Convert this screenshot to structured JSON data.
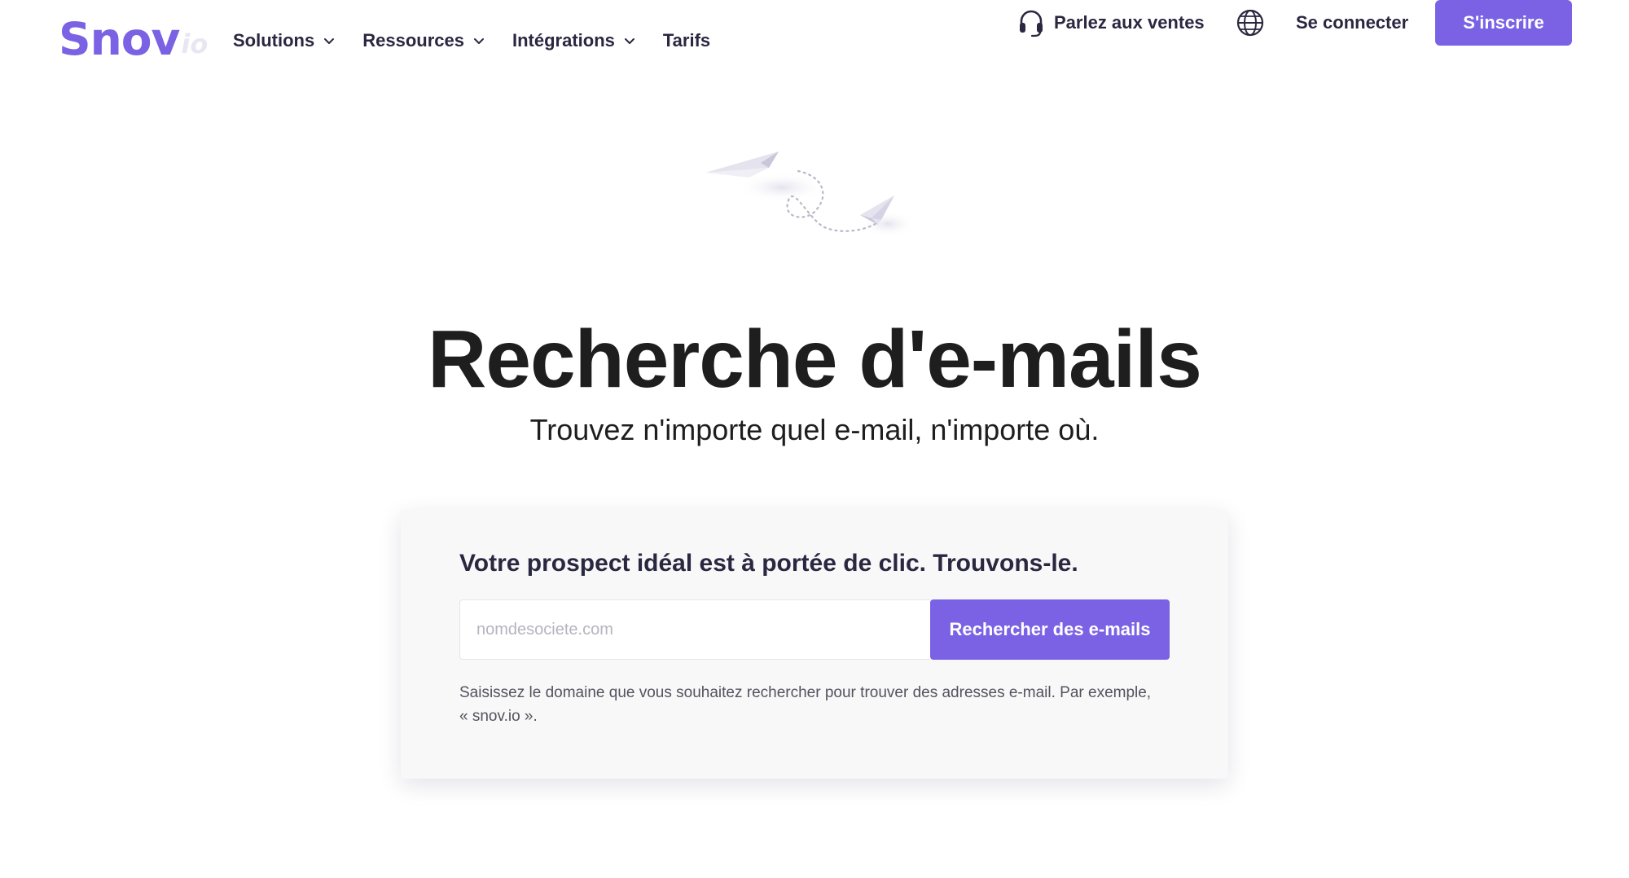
{
  "brand": {
    "logo_main": "Snov",
    "logo_suffix": "io",
    "accent_color": "#7b62e4"
  },
  "nav": {
    "menu": [
      {
        "label": "Solutions",
        "has_dropdown": true
      },
      {
        "label": "Ressources",
        "has_dropdown": true
      },
      {
        "label": "Intégrations",
        "has_dropdown": true
      },
      {
        "label": "Tarifs",
        "has_dropdown": false
      }
    ],
    "sales_label": "Parlez aux ventes",
    "sales_icon": "headset-icon",
    "language_icon": "globe-icon",
    "login_label": "Se connecter",
    "signup_label": "S'inscrire"
  },
  "hero": {
    "illustration": "paper-planes-icon",
    "title": "Recherche d'e-mails",
    "subtitle": "Trouvez n'importe quel e-mail, n'importe où."
  },
  "search_card": {
    "title": "Votre prospect idéal est à portée de clic. Trouvons-le.",
    "input_placeholder": "nomdesociete.com",
    "input_value": "",
    "button_label": "Rechercher des e-mails",
    "help_text": "Saisissez le domaine que vous souhaitez rechercher pour trouver des adresses e-mail. Par exemple, « snov.io »."
  }
}
